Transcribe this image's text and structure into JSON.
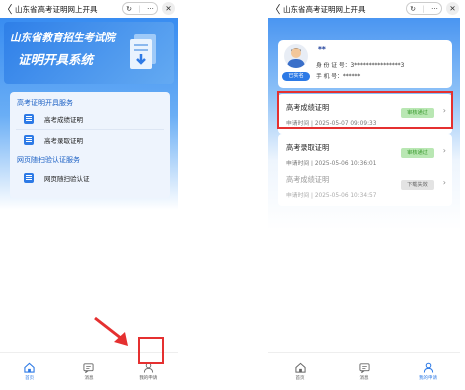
{
  "screen1": {
    "nav": {
      "back": "〈",
      "title": "山东省高考证明网上开具",
      "refresh": "↻",
      "more": "···",
      "close": "✕"
    },
    "banner": {
      "line1": "山东省教育招生考试院",
      "line2": "证明开具系统"
    },
    "sections": [
      {
        "title": "高考证明开具服务",
        "items": [
          "高考成绩证明",
          "高考录取证明"
        ]
      },
      {
        "title": "网页随扫验认证服务",
        "items": [
          "网页随扫验认证"
        ]
      }
    ],
    "tabs": [
      "首页",
      "消息",
      "我的申请"
    ]
  },
  "screen2": {
    "nav": {
      "back": "〈",
      "title": "山东省高考证明网上开具",
      "refresh": "↻",
      "more": "···",
      "close": "✕"
    },
    "profile": {
      "name": "**",
      "tag": "已实名",
      "id_label": "身 份 证 号：",
      "id_value": "3****************3",
      "phone_label": "手   机   号：",
      "phone_value": "******"
    },
    "records": [
      {
        "title": "高考成绩证明",
        "date": "申请时间 | 2025-05-07 09:09:33",
        "status": "审核通过"
      },
      {
        "title": "高考录取证明",
        "date": "申请时间 | 2025-05-06 10:36:01",
        "status": "审核通过"
      },
      {
        "title": "高考成绩证明",
        "date": "申请时间 | 2025-05-06 10:34:57",
        "status": "下载失效"
      }
    ],
    "tabs": [
      "首页",
      "消息",
      "我的申请"
    ]
  },
  "colors": {
    "accent": "#2d7ae6",
    "highlight": "#e53030",
    "approved_bg": "#b9e7b3",
    "approved_text": "#3a9a2e",
    "expired_bg": "#e3e3e3"
  },
  "icons": [
    "back-icon",
    "refresh-icon",
    "more-icon",
    "close-icon",
    "document-icon",
    "home-icon",
    "message-icon",
    "user-icon",
    "arrow-icon",
    "chevron-right-icon"
  ]
}
